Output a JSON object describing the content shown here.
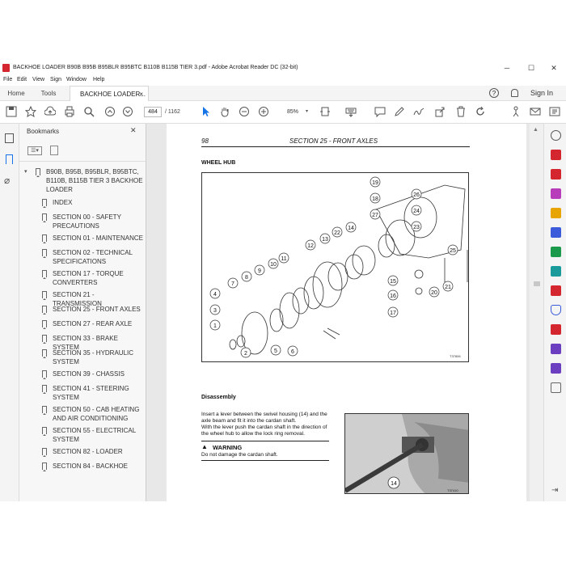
{
  "window": {
    "title": "BACKHOE LOADER B90B B95B B95BLR B95BTC B110B B115B TIER 3.pdf - Adobe Acrobat Reader DC (32-bit)",
    "minimize": "─",
    "maximize": "☐",
    "close": "✕"
  },
  "menu": [
    "File",
    "Edit",
    "View",
    "Sign",
    "Window",
    "Help"
  ],
  "tabs": {
    "home": "Home",
    "tools": "Tools",
    "doc": "BACKHOE LOADER...",
    "doc_close": "×",
    "help": "?",
    "sign_in": "Sign In"
  },
  "toolbar": {
    "page_current": "484",
    "page_total": "/ 1162",
    "zoom": "85%"
  },
  "bookmarks": {
    "title": "Bookmarks",
    "close": "✕",
    "root": "B90B, B95B, B95BLR, B95BTC, B110B, B115B TIER 3 BACKHOE LOADER",
    "items": [
      "INDEX",
      "SECTION 00 - SAFETY PRECAUTIONS",
      "SECTION 01 - MAINTENANCE",
      "SECTION 02 - TECHNICAL SPECIFICATIONS",
      "SECTION 17 - TORQUE CONVERTERS",
      "SECTION 21 - TRANSMISSION",
      "SECTION 25 - FRONT AXLES",
      "SECTION 27 - REAR AXLE",
      "SECTION 33 - BRAKE SYSTEM",
      "SECTION 35 - HYDRAULIC SYSTEM",
      "SECTION 39 - CHASSIS",
      "SECTION 41 - STEERING SYSTEM",
      "SECTION 50 - CAB HEATING AND AIR CONDITIONING",
      "SECTION 55 - ELECTRICAL SYSTEM",
      "SECTION 82 - LOADER",
      "SECTION 84 - BACKHOE"
    ]
  },
  "page": {
    "number": "98",
    "section": "SECTION 25 - FRONT AXLES",
    "heading": "WHEEL HUB",
    "figure_code": "T37806",
    "callouts": [
      "19",
      "18",
      "26",
      "27",
      "24",
      "23",
      "25",
      "14",
      "22",
      "13",
      "12",
      "11",
      "10",
      "9",
      "8",
      "7",
      "15",
      "16",
      "17",
      "20",
      "21",
      "4",
      "3",
      "1",
      "2",
      "5",
      "6"
    ],
    "disassembly_heading": "Disassembly",
    "paragraph_1": "Insert a lever between the swivel housing (14) and the axle beam and fit it into the cardan shaft.",
    "paragraph_2": "With the lever push the cardan shaft in the direction of the wheel hub to allow the lock ring removal.",
    "warning_title": "WARNING",
    "warning_text": "Do not damage the cardan shaft.",
    "photo_callout": "14",
    "photo_code": "T37410"
  },
  "colors": {
    "accent_blue": "#1473e6",
    "acrobat_red": "#d3262f"
  }
}
